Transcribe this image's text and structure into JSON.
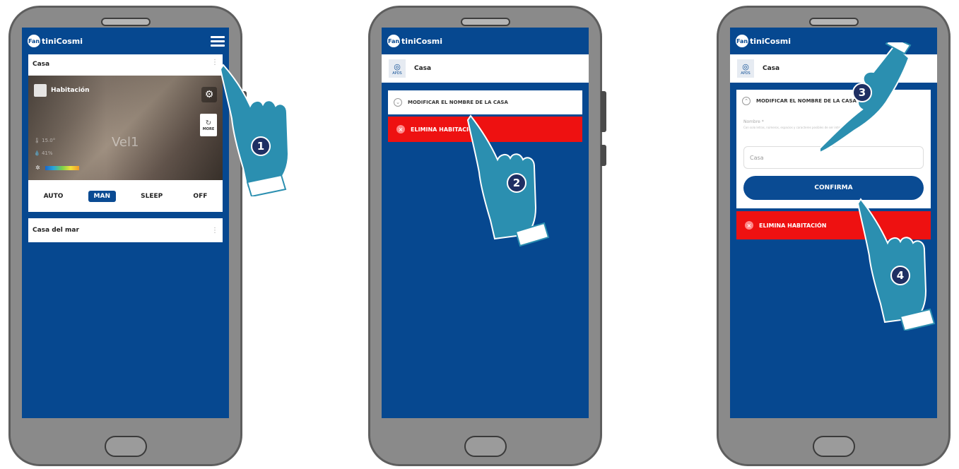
{
  "brand": {
    "logo_mark": "Fan",
    "logo_text": "tiniCosmi"
  },
  "screen1": {
    "home1": {
      "title": "Casa",
      "menu": "⋮"
    },
    "room": {
      "name": "Habitación",
      "velocity": "Vel1",
      "temp": "15.0°",
      "humidity": "41%",
      "more_label": "MORE"
    },
    "modes": [
      {
        "label": "AUTO",
        "active": false
      },
      {
        "label": "MAN",
        "active": true
      },
      {
        "label": "SLEEP",
        "active": false
      },
      {
        "label": "OFF",
        "active": false
      }
    ],
    "home2": {
      "title": "Casa del mar",
      "menu": "⋮"
    }
  },
  "screen2": {
    "apto_label": "APDS",
    "header_title": "Casa",
    "rename_label": "MODIFICAR EL NOMBRE DE LA CASA",
    "delete_label": "ELIMINA HABITACIÓN"
  },
  "screen3": {
    "apto_label": "APDS",
    "header_title": "Casa",
    "rename_label": "MODIFICAR EL NOMBRE DE LA CASA",
    "field_label": "Nombre *",
    "field_hint": "Con solo letras, números, espacios y caracteres posibles de ser introducidos",
    "field_value": "Casa",
    "confirm_label": "CONFIRMA",
    "delete_label": "ELIMINA HABITACIÓN"
  },
  "steps": [
    "1",
    "2",
    "3",
    "4"
  ],
  "colors": {
    "bg": "#064890",
    "accent": "#0a4b93",
    "danger": "#ee1111",
    "hand": "#2b8fb0",
    "phone": "#8a8a8a"
  }
}
